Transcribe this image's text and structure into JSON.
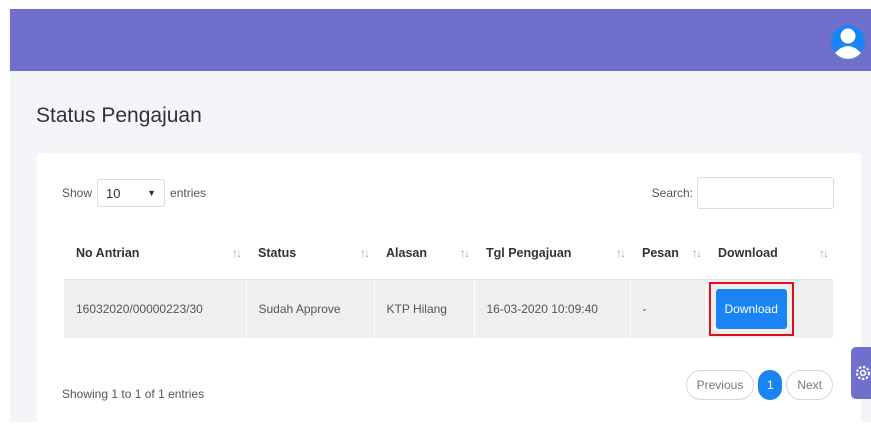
{
  "page": {
    "title": "Status Pengajuan"
  },
  "length": {
    "show_label": "Show",
    "value": "10",
    "entries_label": "entries"
  },
  "search": {
    "label": "Search:",
    "value": ""
  },
  "table": {
    "headers": [
      "No Antrian",
      "Status",
      "Alasan",
      "Tgl Pengajuan",
      "Pesan",
      "Download"
    ],
    "rows": [
      [
        "16032020/00000223/30",
        "Sudah Approve",
        "KTP Hilang",
        "16-03-2020 10:09:40",
        "-",
        "Download"
      ]
    ]
  },
  "footer": {
    "info": "Showing 1 to 1 of 1 entries"
  },
  "pagination": {
    "previous": "Previous",
    "current": "1",
    "next": "Next"
  },
  "colors": {
    "topbar": "#7070cc",
    "primary": "#1a84f5",
    "highlight": "#e0101a",
    "background": "#f4f5f9"
  },
  "icons": {
    "avatar": "user-avatar-icon",
    "sort": "sort-arrows-icon",
    "settings": "gear-icon"
  }
}
